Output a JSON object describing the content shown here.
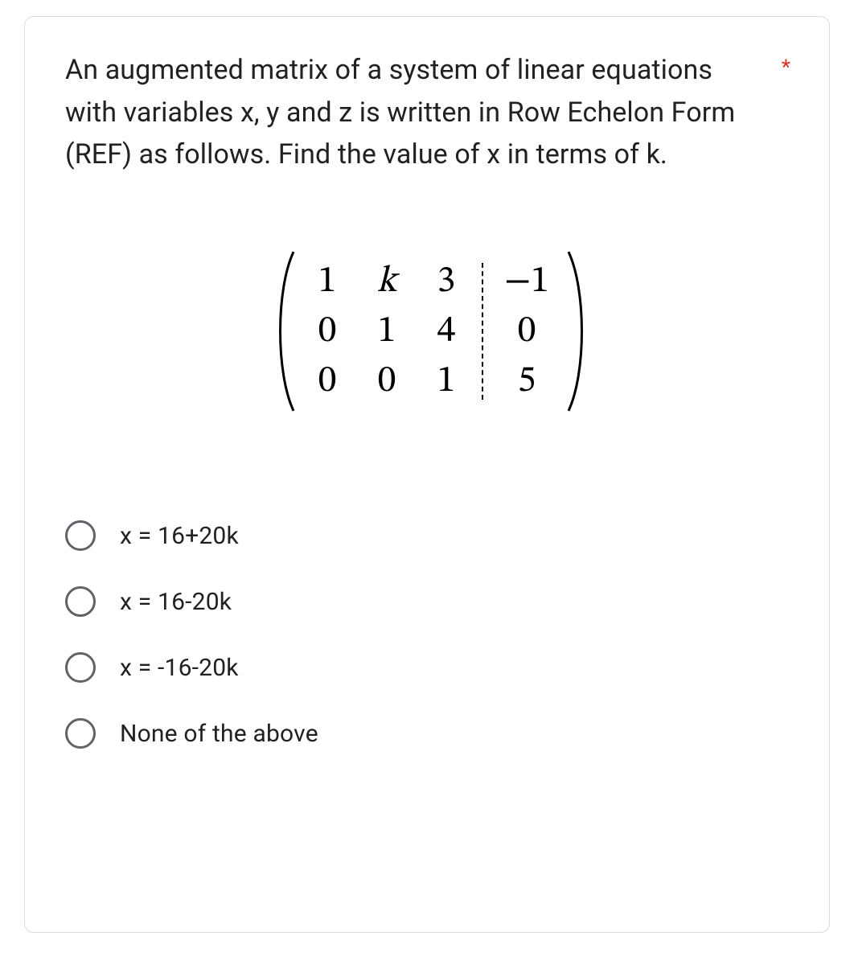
{
  "question": {
    "text": "An augmented matrix of a system of linear equations with variables x, y and z  is written in Row Echelon Form (REF) as follows. Find the value of x in terms of k.",
    "required_marker": "*"
  },
  "matrix": {
    "r1c1": "1",
    "r1c2": "k",
    "r1c3": "3",
    "r1aug": "−1",
    "r2c1": "0",
    "r2c2": "1",
    "r2c3": "4",
    "r2aug": "0",
    "r3c1": "0",
    "r3c2": "0",
    "r3c3": "1",
    "r3aug": "5"
  },
  "options": [
    {
      "label": "x = 16+20k"
    },
    {
      "label": "x = 16-20k"
    },
    {
      "label": "x = -16-20k"
    },
    {
      "label": "None of the above"
    }
  ]
}
